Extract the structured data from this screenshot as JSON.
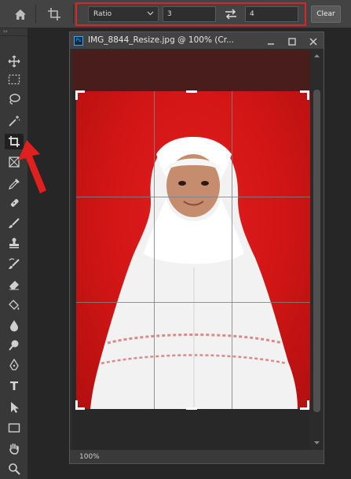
{
  "options_bar": {
    "aspect_select": "Ratio",
    "width_value": "3",
    "height_value": "4",
    "clear_label": "Clear",
    "highlight_color": "#d8262b"
  },
  "toolbar": {
    "expand_label": "››",
    "tools": [
      "move-tool",
      "marquee-tool",
      "lasso-tool",
      "magic-wand-tool",
      "crop-tool",
      "frame-tool",
      "eyedropper-tool",
      "healing-brush-tool",
      "brush-tool",
      "clone-stamp-tool",
      "history-brush-tool",
      "eraser-tool",
      "paint-bucket-tool",
      "blur-tool",
      "dodge-tool",
      "pen-tool",
      "type-tool",
      "path-selection-tool",
      "rectangle-tool",
      "hand-tool",
      "zoom-tool"
    ],
    "active_tool": "crop-tool",
    "type_glyph": "T"
  },
  "document": {
    "title": "IMG_8844_Resize.jpg @ 100% (Cr...",
    "ps_badge": "Ps",
    "zoom": "100%"
  },
  "colors": {
    "background_red": "#d01515",
    "annotation_arrow": "#e0201f"
  }
}
